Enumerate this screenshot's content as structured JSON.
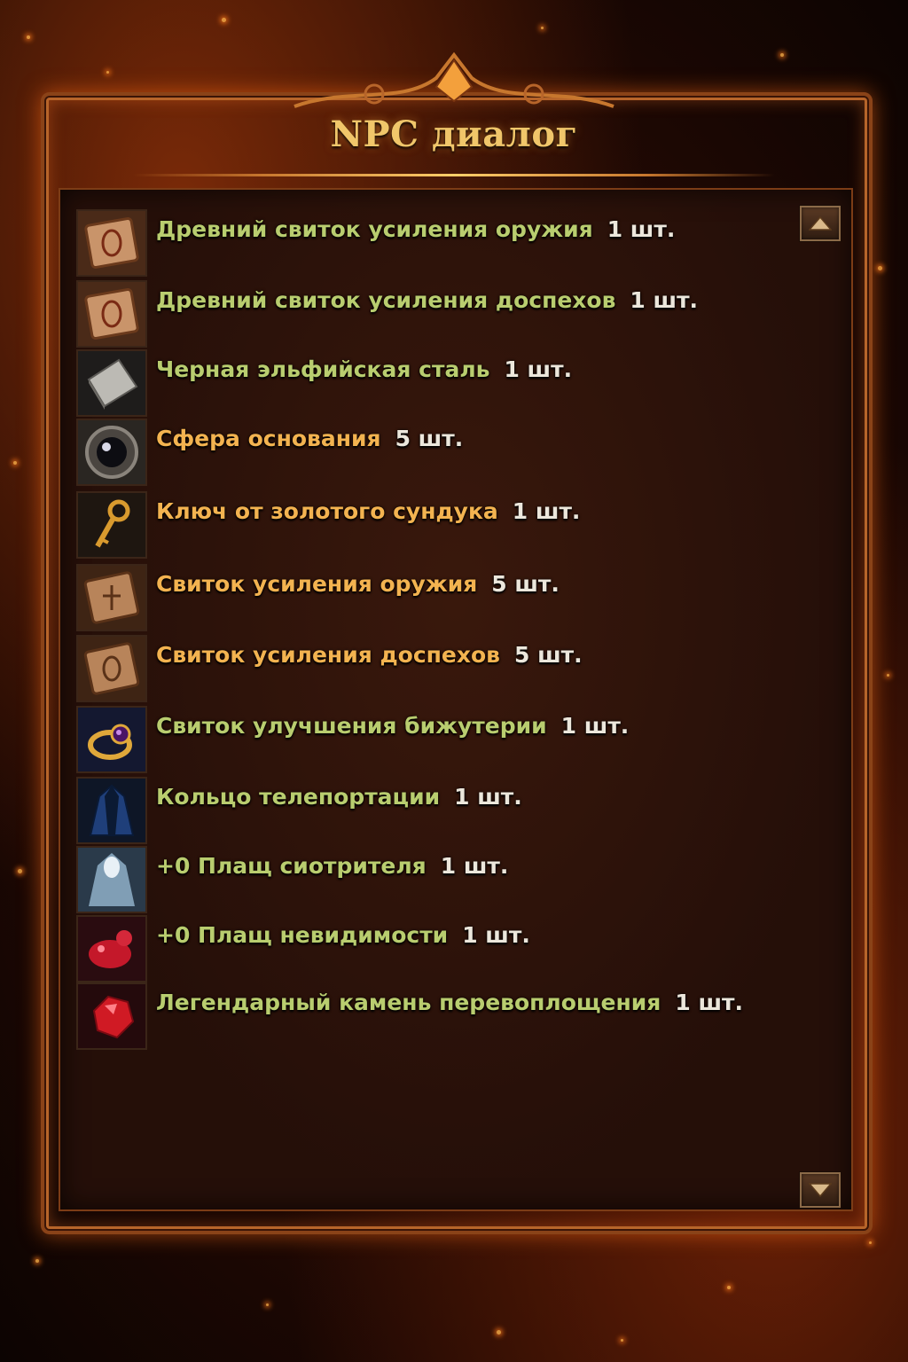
{
  "dialog": {
    "title": "NPC диалог"
  },
  "items": [
    {
      "name": "Древний свиток усиления оружия",
      "qty": "1 шт.",
      "color": "#b9cd6f",
      "icon": "ancient-scroll-icon"
    },
    {
      "name": "Древний свиток усиления доспехов",
      "qty": "1 шт.",
      "color": "#b9cd6f",
      "icon": "ancient-scroll-icon"
    },
    {
      "name": "Черная эльфийская сталь",
      "qty": "1 шт.",
      "color": "#b9cd6f",
      "icon": "steel-plate-icon"
    },
    {
      "name": "Сфера основания",
      "qty": "5 шт.",
      "color": "#f3b350",
      "icon": "sphere-icon"
    },
    {
      "name": "Ключ от золотого сундука",
      "qty": "1 шт.",
      "color": "#f3b350",
      "icon": "golden-key-icon"
    },
    {
      "name": "Свиток усиления оружия",
      "qty": "5 шт.",
      "color": "#f3b350",
      "icon": "scroll-icon"
    },
    {
      "name": "Свиток усиления доспехов",
      "qty": "5 шт.",
      "color": "#f3b350",
      "icon": "scroll-icon"
    },
    {
      "name": "Свиток улучшения бижутерии",
      "qty": "1 шт.",
      "color": "#b9cd6f",
      "icon": "ring-icon"
    },
    {
      "name": "Кольцо телепортации",
      "qty": "1 шт.",
      "color": "#b9cd6f",
      "icon": "dark-cloak-icon"
    },
    {
      "name": "+0 Плащ сиотрителя",
      "qty": "1 шт.",
      "color": "#b9cd6f",
      "icon": "light-cloak-icon"
    },
    {
      "name": "+0 Плащ невидимости",
      "qty": "1 шт.",
      "color": "#b9cd6f",
      "icon": "red-creature-icon"
    },
    {
      "name": "Легендарный камень перевоплощения",
      "qty": "1 шт.",
      "color": "#b9cd6f",
      "icon": "red-gem-icon"
    }
  ],
  "scroll": {
    "up_icon": "triangle-up-icon",
    "down_icon": "triangle-down-icon"
  },
  "colors": {
    "title": "#f0c66a",
    "frame": "#b7652a",
    "quantity": "#ece7dc"
  }
}
